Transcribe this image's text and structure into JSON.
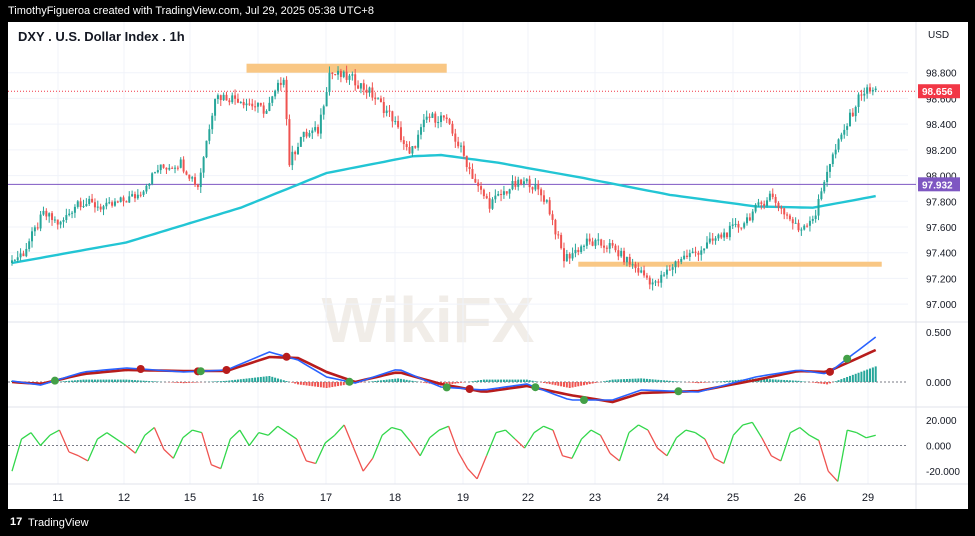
{
  "header": {
    "credit": "TimothyFigueroa created with TradingView.com, Jul 29, 2025 05:38 UTC+8"
  },
  "footer": {
    "logo": "17",
    "brand": "TradingView"
  },
  "watermark": "WikiFX",
  "colors": {
    "up": "#26a69a",
    "down": "#ef5350",
    "ma": "#22c5d4",
    "level": "#7e57c2",
    "zone": "#f9c784",
    "last": "#f23645",
    "macd_fast": "#2962ff",
    "macd_slow": "#b71c1c",
    "osc_up": "#32d74b",
    "osc_down": "#ef5350"
  },
  "chart_data": [
    {
      "type": "candlestick",
      "title": "DXY . U.S. Dollar Index . 1h",
      "currency": "USD",
      "ylim": [
        96.9,
        99.0
      ],
      "y_ticks": [
        "98.800",
        "98.600",
        "98.400",
        "98.200",
        "98.000",
        "97.800",
        "97.600",
        "97.400",
        "97.200",
        "97.000"
      ],
      "x_ticks": [
        "11",
        "12",
        "15",
        "16",
        "17",
        "18",
        "19",
        "22",
        "23",
        "24",
        "25",
        "26",
        "29"
      ],
      "price_path": [
        [
          0,
          97.32
        ],
        [
          5,
          97.4
        ],
        [
          12,
          97.7
        ],
        [
          18,
          97.62
        ],
        [
          24,
          97.8
        ],
        [
          34,
          97.75
        ],
        [
          45,
          97.85
        ],
        [
          52,
          98.05
        ],
        [
          60,
          98.1
        ],
        [
          66,
          97.92
        ],
        [
          72,
          98.62
        ],
        [
          80,
          98.6
        ],
        [
          90,
          98.5
        ],
        [
          96,
          98.78
        ],
        [
          98,
          98.1
        ],
        [
          102,
          98.3
        ],
        [
          108,
          98.35
        ],
        [
          112,
          98.8
        ],
        [
          120,
          98.75
        ],
        [
          126,
          98.65
        ],
        [
          134,
          98.45
        ],
        [
          140,
          98.15
        ],
        [
          146,
          98.45
        ],
        [
          152,
          98.45
        ],
        [
          158,
          98.2
        ],
        [
          164,
          97.9
        ],
        [
          168,
          97.78
        ],
        [
          176,
          97.92
        ],
        [
          182,
          97.95
        ],
        [
          188,
          97.8
        ],
        [
          194,
          97.35
        ],
        [
          202,
          97.48
        ],
        [
          210,
          97.45
        ],
        [
          218,
          97.3
        ],
        [
          226,
          97.15
        ],
        [
          234,
          97.35
        ],
        [
          240,
          97.4
        ],
        [
          248,
          97.52
        ],
        [
          256,
          97.62
        ],
        [
          266,
          97.85
        ],
        [
          276,
          97.58
        ],
        [
          282,
          97.7
        ],
        [
          286,
          98.05
        ],
        [
          292,
          98.35
        ],
        [
          298,
          98.65
        ],
        [
          302,
          98.66
        ]
      ],
      "moving_average": [
        [
          0,
          97.32
        ],
        [
          40,
          97.48
        ],
        [
          80,
          97.75
        ],
        [
          110,
          98.02
        ],
        [
          140,
          98.15
        ],
        [
          150,
          98.16
        ],
        [
          170,
          98.1
        ],
        [
          200,
          97.98
        ],
        [
          230,
          97.85
        ],
        [
          260,
          97.76
        ],
        [
          280,
          97.75
        ],
        [
          302,
          97.84
        ]
      ],
      "horizontal_level": 97.932,
      "horizontal_level_label": "97.932",
      "last_price": 98.656,
      "last_price_label": "98.656",
      "resistance_zone": {
        "x": [
          82,
          152
        ],
        "y": [
          98.82,
          98.87
        ]
      },
      "support_zone": {
        "x": [
          198,
          302
        ],
        "y": [
          97.31,
          97.33
        ]
      }
    },
    {
      "type": "line",
      "name": "macd",
      "ylim": [
        -0.25,
        0.6
      ],
      "y_ticks": [
        "0.500",
        "0.000"
      ],
      "fast_line": [
        [
          0,
          0.01
        ],
        [
          10,
          -0.03
        ],
        [
          25,
          0.1
        ],
        [
          40,
          0.14
        ],
        [
          60,
          0.1
        ],
        [
          75,
          0.12
        ],
        [
          90,
          0.3
        ],
        [
          100,
          0.22
        ],
        [
          110,
          0.05
        ],
        [
          120,
          -0.01
        ],
        [
          135,
          0.13
        ],
        [
          150,
          -0.05
        ],
        [
          165,
          -0.08
        ],
        [
          180,
          -0.02
        ],
        [
          195,
          -0.18
        ],
        [
          210,
          -0.18
        ],
        [
          220,
          -0.08
        ],
        [
          240,
          -0.1
        ],
        [
          260,
          0.05
        ],
        [
          275,
          0.12
        ],
        [
          285,
          0.08
        ],
        [
          302,
          0.45
        ]
      ],
      "slow_line": [
        [
          0,
          0.0
        ],
        [
          10,
          -0.02
        ],
        [
          25,
          0.08
        ],
        [
          40,
          0.12
        ],
        [
          60,
          0.11
        ],
        [
          75,
          0.11
        ],
        [
          90,
          0.25
        ],
        [
          100,
          0.24
        ],
        [
          110,
          0.1
        ],
        [
          120,
          0.0
        ],
        [
          135,
          0.1
        ],
        [
          150,
          -0.02
        ],
        [
          165,
          -0.1
        ],
        [
          180,
          -0.04
        ],
        [
          195,
          -0.13
        ],
        [
          210,
          -0.2
        ],
        [
          220,
          -0.11
        ],
        [
          240,
          -0.09
        ],
        [
          260,
          0.02
        ],
        [
          275,
          0.11
        ],
        [
          285,
          0.1
        ],
        [
          302,
          0.32
        ]
      ],
      "cross_down": [
        45,
        65,
        75,
        96,
        160,
        286
      ],
      "cross_up": [
        15,
        66,
        118,
        152,
        183,
        200,
        233,
        292
      ]
    },
    {
      "type": "line",
      "name": "oscillator",
      "ylim": [
        -30,
        30
      ],
      "y_ticks": [
        "20.000",
        "0.000",
        "-20.000"
      ],
      "values": [
        -20,
        5,
        10,
        0,
        8,
        12,
        -5,
        -8,
        -12,
        5,
        10,
        5,
        0,
        -6,
        8,
        14,
        -3,
        -10,
        6,
        12,
        10,
        -15,
        -18,
        5,
        12,
        0,
        10,
        8,
        15,
        10,
        5,
        -12,
        -14,
        2,
        8,
        16,
        -2,
        -20,
        -10,
        8,
        14,
        12,
        3,
        -8,
        6,
        12,
        15,
        -5,
        -18,
        -26,
        -8,
        10,
        12,
        5,
        -2,
        10,
        15,
        12,
        -8,
        -10,
        5,
        12,
        8,
        -6,
        -12,
        10,
        16,
        12,
        -2,
        -8,
        6,
        12,
        10,
        5,
        -10,
        -14,
        8,
        16,
        18,
        6,
        -8,
        -12,
        10,
        14,
        8,
        4,
        -20,
        -28,
        12,
        10,
        6,
        8
      ]
    }
  ]
}
